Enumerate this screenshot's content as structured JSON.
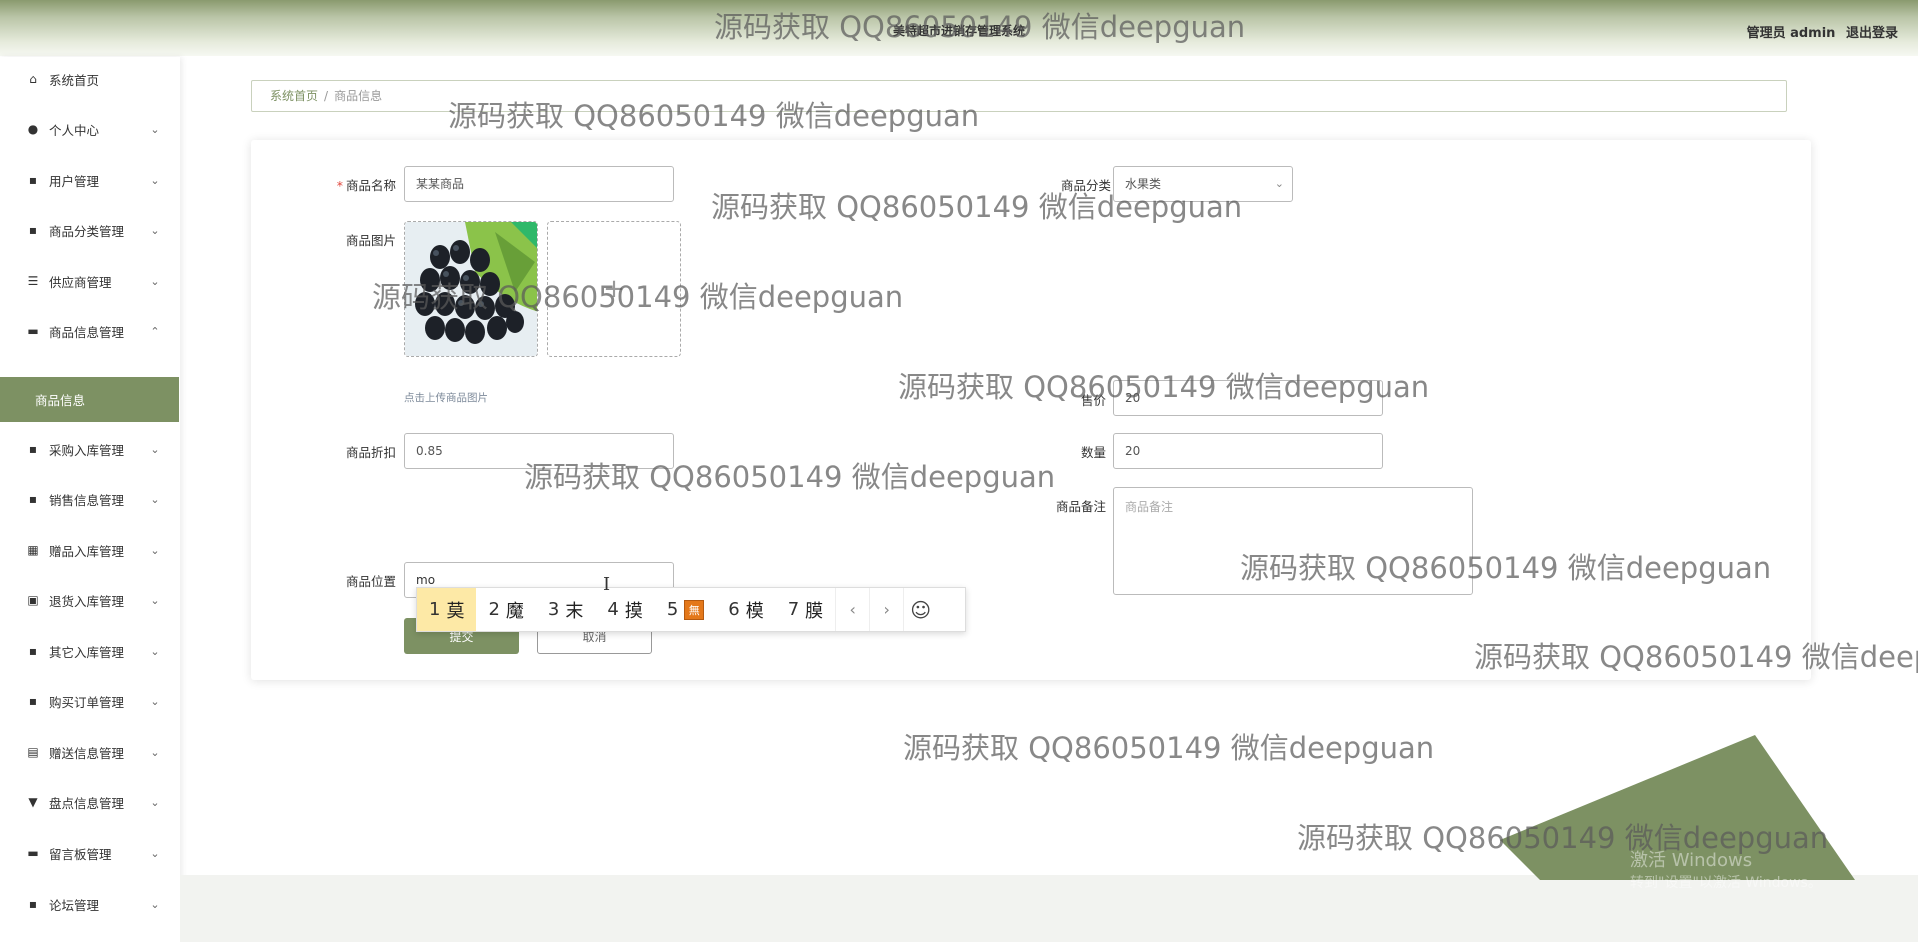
{
  "app": {
    "title": "美特超市进销存管理系统"
  },
  "top_right": {
    "user_label": "管理员 admin",
    "logout_label": "退出登录"
  },
  "sidebar": {
    "items": [
      {
        "label": "系统首页",
        "icon": "home-icon",
        "glyph": "⌂",
        "arrow": ""
      },
      {
        "label": "个人中心",
        "icon": "user-icon",
        "glyph": "●",
        "arrow": "⌄"
      },
      {
        "label": "用户管理",
        "icon": "grid-icon",
        "glyph": "▪",
        "arrow": "⌄"
      },
      {
        "label": "商品分类管理",
        "icon": "grid-icon",
        "glyph": "▪",
        "arrow": "⌄"
      },
      {
        "label": "供应商管理",
        "icon": "list-icon",
        "glyph": "☰",
        "arrow": "⌄"
      },
      {
        "label": "商品信息管理",
        "icon": "chat-icon",
        "glyph": "▬",
        "arrow": "⌃"
      },
      {
        "label": "采购入库管理",
        "icon": "grid-icon",
        "glyph": "▪",
        "arrow": "⌄"
      },
      {
        "label": "销售信息管理",
        "icon": "grid-icon",
        "glyph": "▪",
        "arrow": "⌄"
      },
      {
        "label": "赠品入库管理",
        "icon": "apps-icon",
        "glyph": "▦",
        "arrow": "⌄"
      },
      {
        "label": "退货入库管理",
        "icon": "return-icon",
        "glyph": "▣",
        "arrow": "⌄"
      },
      {
        "label": "其它入库管理",
        "icon": "grid-icon",
        "glyph": "▪",
        "arrow": "⌄"
      },
      {
        "label": "购买订单管理",
        "icon": "grid-icon",
        "glyph": "▪",
        "arrow": "⌄"
      },
      {
        "label": "赠送信息管理",
        "icon": "clipboard-icon",
        "glyph": "▤",
        "arrow": "⌄"
      },
      {
        "label": "盘点信息管理",
        "icon": "inventory-icon",
        "glyph": "▼",
        "arrow": "⌄"
      },
      {
        "label": "留言板管理",
        "icon": "board-icon",
        "glyph": "▬",
        "arrow": "⌄"
      },
      {
        "label": "论坛管理",
        "icon": "grid-icon",
        "glyph": "▪",
        "arrow": "⌄"
      }
    ],
    "active_sub": "商品信息"
  },
  "breadcrumb": {
    "home": "系统首页",
    "sep": "/",
    "current": "商品信息"
  },
  "form": {
    "name": {
      "label": "商品名称",
      "required_mark": "*",
      "value": "某某商品"
    },
    "category": {
      "label": "商品分类",
      "value": "水果类"
    },
    "image": {
      "label": "商品图片",
      "hint": "点击上传商品图片"
    },
    "price": {
      "label": "售价",
      "value": "20"
    },
    "discount": {
      "label": "商品折扣",
      "value": "0.85"
    },
    "quantity": {
      "label": "数量",
      "value": "20"
    },
    "remark": {
      "label": "商品备注",
      "placeholder": "商品备注"
    },
    "location": {
      "label": "商品位置",
      "value": "mo"
    },
    "submit_label": "提交",
    "cancel_label": "取消"
  },
  "ime": {
    "candidates": [
      {
        "n": "1",
        "c": "莫"
      },
      {
        "n": "2",
        "c": "魔"
      },
      {
        "n": "3",
        "c": "末"
      },
      {
        "n": "4",
        "c": "摸"
      },
      {
        "n": "5",
        "c": "無"
      },
      {
        "n": "6",
        "c": "模"
      },
      {
        "n": "7",
        "c": "膜"
      }
    ],
    "prev": "‹",
    "next": "›",
    "emoji": "☺"
  },
  "watermark": "源码获取 QQ86050149 微信deepguan",
  "windows": {
    "line1": "激活 Windows",
    "line2": "转到\"设置\"以激活 Windows。"
  },
  "colors": {
    "accent": "#7d9163",
    "required": "#e0463c"
  }
}
